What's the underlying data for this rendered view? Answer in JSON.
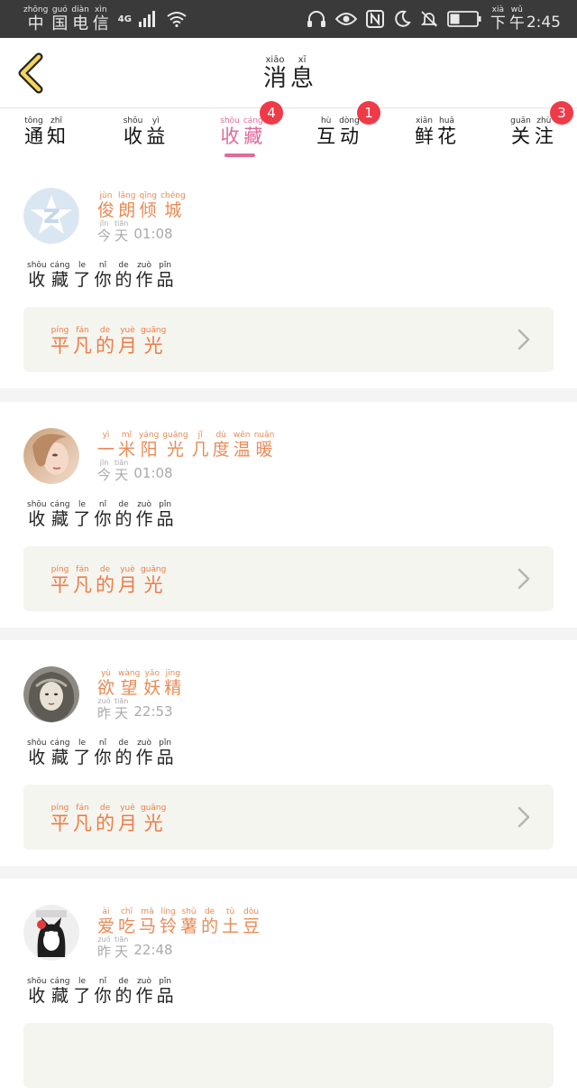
{
  "status_bar": {
    "carrier": [
      [
        "zhōng",
        "中"
      ],
      [
        "guó",
        "国"
      ],
      [
        "diàn",
        "电"
      ],
      [
        "xìn",
        "信"
      ]
    ],
    "network": "4G",
    "time_period": [
      [
        "xià",
        "下"
      ],
      [
        "wǔ",
        "午"
      ]
    ],
    "time": "2:45",
    "icons": [
      "signal-icon",
      "wifi-icon",
      "headphones-icon",
      "eye-icon",
      "nfc-icon",
      "moon-icon",
      "mute-bell-icon",
      "battery-icon"
    ]
  },
  "header": {
    "title": [
      [
        "xiāo",
        "消"
      ],
      [
        "xī",
        "息"
      ]
    ],
    "back_icon": "chevron-left-icon"
  },
  "tabs": [
    {
      "name": "tab-notifications",
      "chars": [
        [
          "tōng",
          "通"
        ],
        [
          "zhī",
          "知"
        ]
      ],
      "badge": ""
    },
    {
      "name": "tab-earnings",
      "chars": [
        [
          "shōu",
          "收"
        ],
        [
          "yì",
          "益"
        ]
      ],
      "badge": ""
    },
    {
      "name": "tab-favorites",
      "chars": [
        [
          "shōu",
          "收"
        ],
        [
          "cáng",
          "藏"
        ]
      ],
      "badge": "4",
      "active": true
    },
    {
      "name": "tab-interactions",
      "chars": [
        [
          "hù",
          "互"
        ],
        [
          "dòng",
          "动"
        ]
      ],
      "badge": "1"
    },
    {
      "name": "tab-flowers",
      "chars": [
        [
          "xiān",
          "鲜"
        ],
        [
          "huā",
          "花"
        ]
      ],
      "badge": ""
    },
    {
      "name": "tab-follow",
      "chars": [
        [
          "guān",
          "关"
        ],
        [
          "zhù",
          "注"
        ]
      ],
      "badge": "3"
    }
  ],
  "accent_color": "#e06a9a",
  "name_color": "#e98a55",
  "messages": [
    {
      "avatar": "default-q-avatar",
      "user": [
        [
          "jùn",
          "俊"
        ],
        [
          "lǎng",
          "朗"
        ],
        [
          "qīng",
          "倾"
        ],
        [
          "chéng",
          "城"
        ]
      ],
      "day": [
        [
          "jīn",
          "今"
        ],
        [
          "tiān",
          "天"
        ]
      ],
      "time": "01:08",
      "action": [
        [
          "shōu",
          "收"
        ],
        [
          "cáng",
          "藏"
        ],
        [
          "le",
          "了"
        ],
        [
          "nǐ",
          "你"
        ],
        [
          "de",
          "的"
        ],
        [
          "zuò",
          "作"
        ],
        [
          "pǐn",
          "品"
        ]
      ],
      "work": [
        [
          "píng",
          "平"
        ],
        [
          "fán",
          "凡"
        ],
        [
          "de",
          "的"
        ],
        [
          "yuè",
          "月"
        ],
        [
          "guāng",
          "光"
        ]
      ]
    },
    {
      "avatar": "photo-avatar",
      "user": [
        [
          "yì",
          "一"
        ],
        [
          "mǐ",
          "米"
        ],
        [
          "yáng",
          "阳"
        ],
        [
          "guāng",
          "光"
        ],
        [
          "jǐ",
          "几"
        ],
        [
          "dù",
          "度"
        ],
        [
          "wēn",
          "温"
        ],
        [
          "nuǎn",
          "暖"
        ]
      ],
      "day": [
        [
          "jīn",
          "今"
        ],
        [
          "tiān",
          "天"
        ]
      ],
      "time": "01:08",
      "action": [
        [
          "shōu",
          "收"
        ],
        [
          "cáng",
          "藏"
        ],
        [
          "le",
          "了"
        ],
        [
          "nǐ",
          "你"
        ],
        [
          "de",
          "的"
        ],
        [
          "zuò",
          "作"
        ],
        [
          "pǐn",
          "品"
        ]
      ],
      "work": [
        [
          "píng",
          "平"
        ],
        [
          "fán",
          "凡"
        ],
        [
          "de",
          "的"
        ],
        [
          "yuè",
          "月"
        ],
        [
          "guāng",
          "光"
        ]
      ]
    },
    {
      "avatar": "illustration-avatar",
      "user": [
        [
          "yù",
          "欲"
        ],
        [
          "wàng",
          "望"
        ],
        [
          "yāo",
          "妖"
        ],
        [
          "jīng",
          "精"
        ]
      ],
      "day": [
        [
          "zuó",
          "昨"
        ],
        [
          "tiān",
          "天"
        ]
      ],
      "time": "22:53",
      "action": [
        [
          "shōu",
          "收"
        ],
        [
          "cáng",
          "藏"
        ],
        [
          "le",
          "了"
        ],
        [
          "nǐ",
          "你"
        ],
        [
          "de",
          "的"
        ],
        [
          "zuò",
          "作"
        ],
        [
          "pǐn",
          "品"
        ]
      ],
      "work": [
        [
          "píng",
          "平"
        ],
        [
          "fán",
          "凡"
        ],
        [
          "de",
          "的"
        ],
        [
          "yuè",
          "月"
        ],
        [
          "guāng",
          "光"
        ]
      ]
    },
    {
      "avatar": "cat-avatar",
      "user": [
        [
          "ài",
          "爱"
        ],
        [
          "chī",
          "吃"
        ],
        [
          "mǎ",
          "马"
        ],
        [
          "líng",
          "铃"
        ],
        [
          "shǔ",
          "薯"
        ],
        [
          "de",
          "的"
        ],
        [
          "tǔ",
          "土"
        ],
        [
          "dòu",
          "豆"
        ]
      ],
      "day": [
        [
          "zuó",
          "昨"
        ],
        [
          "tiān",
          "天"
        ]
      ],
      "time": "22:48",
      "action": [
        [
          "shōu",
          "收"
        ],
        [
          "cáng",
          "藏"
        ],
        [
          "le",
          "了"
        ],
        [
          "nǐ",
          "你"
        ],
        [
          "de",
          "的"
        ],
        [
          "zuò",
          "作"
        ],
        [
          "pǐn",
          "品"
        ]
      ],
      "work": []
    }
  ]
}
